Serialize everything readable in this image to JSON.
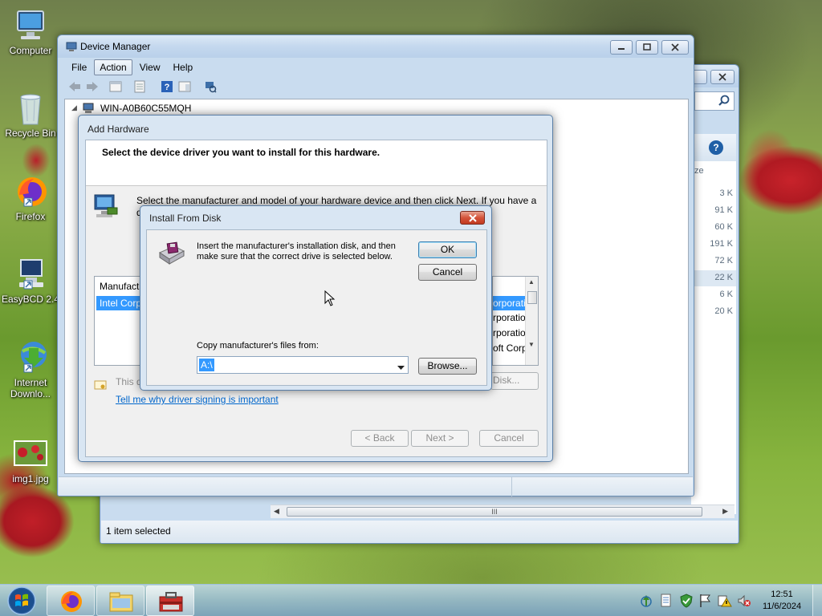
{
  "desktop": {
    "icons": [
      {
        "label": "Computer"
      },
      {
        "label": "Recycle Bin"
      },
      {
        "label": "Firefox"
      },
      {
        "label": "EasyBCD 2.4"
      },
      {
        "label": "Internet Downlo..."
      },
      {
        "label": "img1.jpg"
      }
    ]
  },
  "explorer_bg": {
    "column_header": "ze",
    "sizes": [
      "3 K",
      "91 K",
      "60 K",
      "191 K",
      "72 K",
      "22 K",
      "6 K",
      "20 K"
    ],
    "status": "1 item selected",
    "scroll_grip": "III"
  },
  "device_manager": {
    "title": "Device Manager",
    "menu": [
      "File",
      "Action",
      "View",
      "Help"
    ],
    "tree_root": "WIN-A0B60C55MQH"
  },
  "add_hardware": {
    "title": "Add Hardware",
    "heading": "Select the device driver you want to install for this hardware.",
    "instruction": "Select the manufacturer and model of your hardware device and then click Next. If you have a",
    "instruction_cut": "d",
    "list_header": "Manufact",
    "list_selected": "Intel Corp",
    "right_items": [
      "orporati",
      "rporation",
      "rporatio",
      "oft Corp"
    ],
    "signing_text": "This d",
    "have_disk": "Disk...",
    "signing_link": "Tell me why driver signing is important",
    "back": "< Back",
    "next": "Next >",
    "cancel": "Cancel"
  },
  "install_disk": {
    "title": "Install From Disk",
    "message_line1": "Insert the manufacturer's installation disk, and then",
    "message_line2": "make sure that the correct drive is selected below.",
    "ok": "OK",
    "cancel": "Cancel",
    "copy_label": "Copy manufacturer's files from:",
    "path_value": "A:\\",
    "browse": "Browse..."
  },
  "taskbar": {
    "time": "12:51",
    "date": "11/6/2024"
  }
}
